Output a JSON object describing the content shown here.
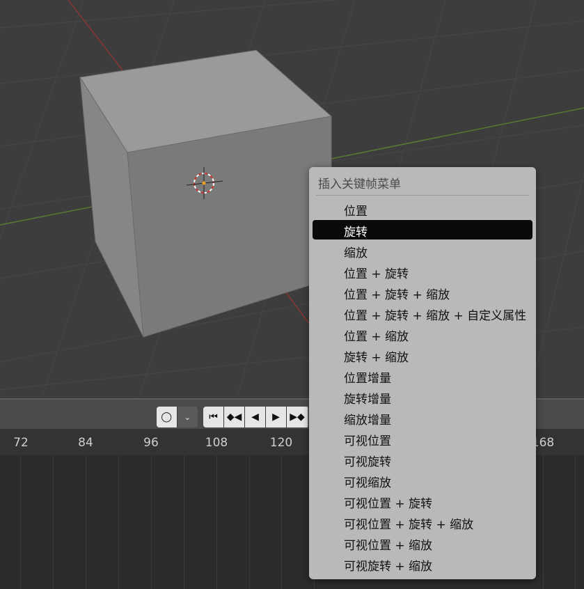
{
  "menu": {
    "title": "插入关键帧菜单",
    "items": [
      {
        "label": "位置"
      },
      {
        "label": "旋转",
        "selected": true
      },
      {
        "label": "缩放"
      },
      {
        "label": "位置 + 旋转"
      },
      {
        "label": "位置 + 旋转 + 缩放"
      },
      {
        "label": "位置 + 旋转 + 缩放 + 自定义属性"
      },
      {
        "label": "位置 + 缩放"
      },
      {
        "label": "旋转 + 缩放"
      },
      {
        "label": "位置增量"
      },
      {
        "label": "旋转增量"
      },
      {
        "label": "缩放增量"
      },
      {
        "label": "可视位置"
      },
      {
        "label": "可视旋转"
      },
      {
        "label": "可视缩放"
      },
      {
        "label": "可视位置 + 旋转"
      },
      {
        "label": "可视位置 + 旋转 + 缩放"
      },
      {
        "label": "可视位置 + 缩放"
      },
      {
        "label": "可视旋转 + 缩放"
      }
    ]
  },
  "timeline": {
    "frame_ticks": [
      "72",
      "84",
      "96",
      "108",
      "120",
      "168"
    ],
    "keying_buttons": [
      "circle-icon",
      "chevron-down-icon"
    ],
    "playback_buttons": [
      "jump-to-start-icon",
      "jump-to-previous-keyframe-icon",
      "play-reverse-icon",
      "play-icon",
      "jump-to-next-keyframe-icon"
    ]
  },
  "colors": {
    "menu_bg": "#b9b9b9",
    "menu_selected": "#0a0a0a",
    "viewport_bg": "#3d3d3d",
    "x_axis": "#8a3535",
    "y_axis": "#5a7a32"
  }
}
